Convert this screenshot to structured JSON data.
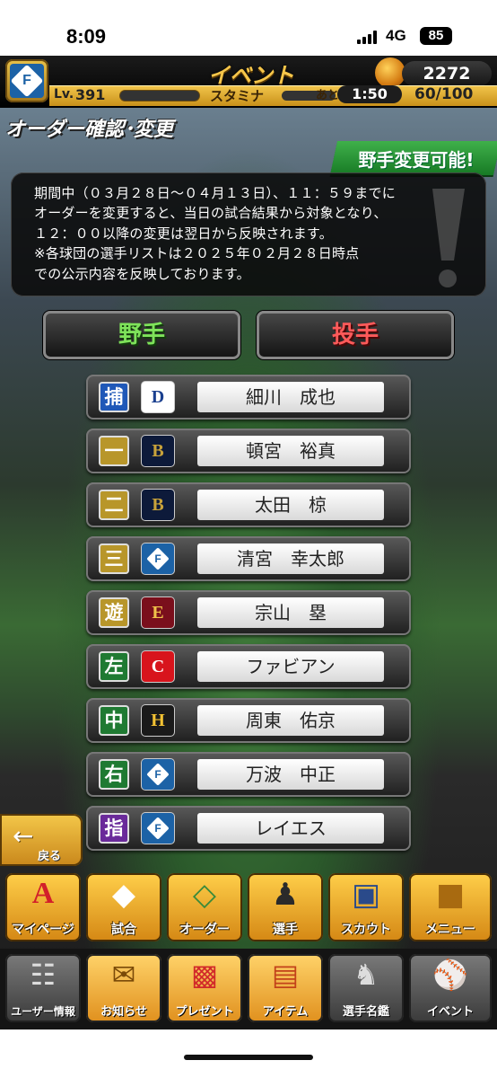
{
  "status_bar": {
    "time": "8:09",
    "network": "4G",
    "battery": "85"
  },
  "header": {
    "title": "イベント",
    "coins": "2272",
    "level_label": "Lv.",
    "level": "391",
    "stamina_label": "スタミナ",
    "recovery_label": "あと",
    "recovery_timer": "1:50",
    "stamina_value": "60/100"
  },
  "page": {
    "title": "オーダー確認･変更",
    "ribbon": "野手変更可能!",
    "notice": "期間中（０３月２８日～０４月１３日）、１１：５９までに\nオーダーを変更すると、当日の試合結果から対象となり、\n１２：００以降の変更は翌日から反映されます。\n※各球団の選手リストは２０２５年０２月２８日時点\nでの公示内容を反映しております。"
  },
  "tabs": {
    "fielder": "野手",
    "pitcher": "投手"
  },
  "lineup": [
    {
      "position": "捕",
      "team": "dragons",
      "team_mark": "D",
      "name": "細川　成也",
      "pos_color": "#1f58b8"
    },
    {
      "position": "一",
      "team": "buffaloes",
      "team_mark": "B",
      "name": "頓宮　裕真",
      "pos_color": "#b8962a"
    },
    {
      "position": "二",
      "team": "buffaloes",
      "team_mark": "B",
      "name": "太田　椋",
      "pos_color": "#b8962a"
    },
    {
      "position": "三",
      "team": "fighters",
      "team_mark": "F",
      "name": "清宮　幸太郎",
      "pos_color": "#b8962a"
    },
    {
      "position": "遊",
      "team": "eagles",
      "team_mark": "E",
      "name": "宗山　塁",
      "pos_color": "#b8962a"
    },
    {
      "position": "左",
      "team": "carp",
      "team_mark": "C",
      "name": "ファビアン",
      "pos_color": "#1f7a32"
    },
    {
      "position": "中",
      "team": "hawks",
      "team_mark": "H",
      "name": "周東　佑京",
      "pos_color": "#1f7a32"
    },
    {
      "position": "右",
      "team": "fighters",
      "team_mark": "F",
      "name": "万波　中正",
      "pos_color": "#1f7a32"
    },
    {
      "position": "指",
      "team": "fighters",
      "team_mark": "F",
      "name": "レイエス",
      "pos_color": "#6a2a9a"
    }
  ],
  "back_button": "戻る",
  "menu_primary": [
    {
      "label": "マイページ",
      "icon": "mypage-icon"
    },
    {
      "label": "試合",
      "icon": "stadium-icon"
    },
    {
      "label": "オーダー",
      "icon": "diamond-field-icon"
    },
    {
      "label": "選手",
      "icon": "player-icon"
    },
    {
      "label": "スカウト",
      "icon": "scout-card-icon"
    },
    {
      "label": "メニュー",
      "icon": "menu-character-icon"
    }
  ],
  "menu_secondary": [
    {
      "label": "ユーザー情報",
      "icon": "user-info-icon"
    },
    {
      "label": "お知らせ",
      "icon": "notice-icon"
    },
    {
      "label": "プレゼント",
      "icon": "gift-icon"
    },
    {
      "label": "アイテム",
      "icon": "item-icon"
    },
    {
      "label": "選手名鑑",
      "icon": "player-directory-icon"
    },
    {
      "label": "イベント",
      "icon": "event-icon"
    }
  ],
  "colors": {
    "accent_gold": "#f1c44a",
    "fielder_green": "#7ee35a",
    "pitcher_red": "#ff5a5a",
    "ribbon_green": "#2f9a3c"
  }
}
